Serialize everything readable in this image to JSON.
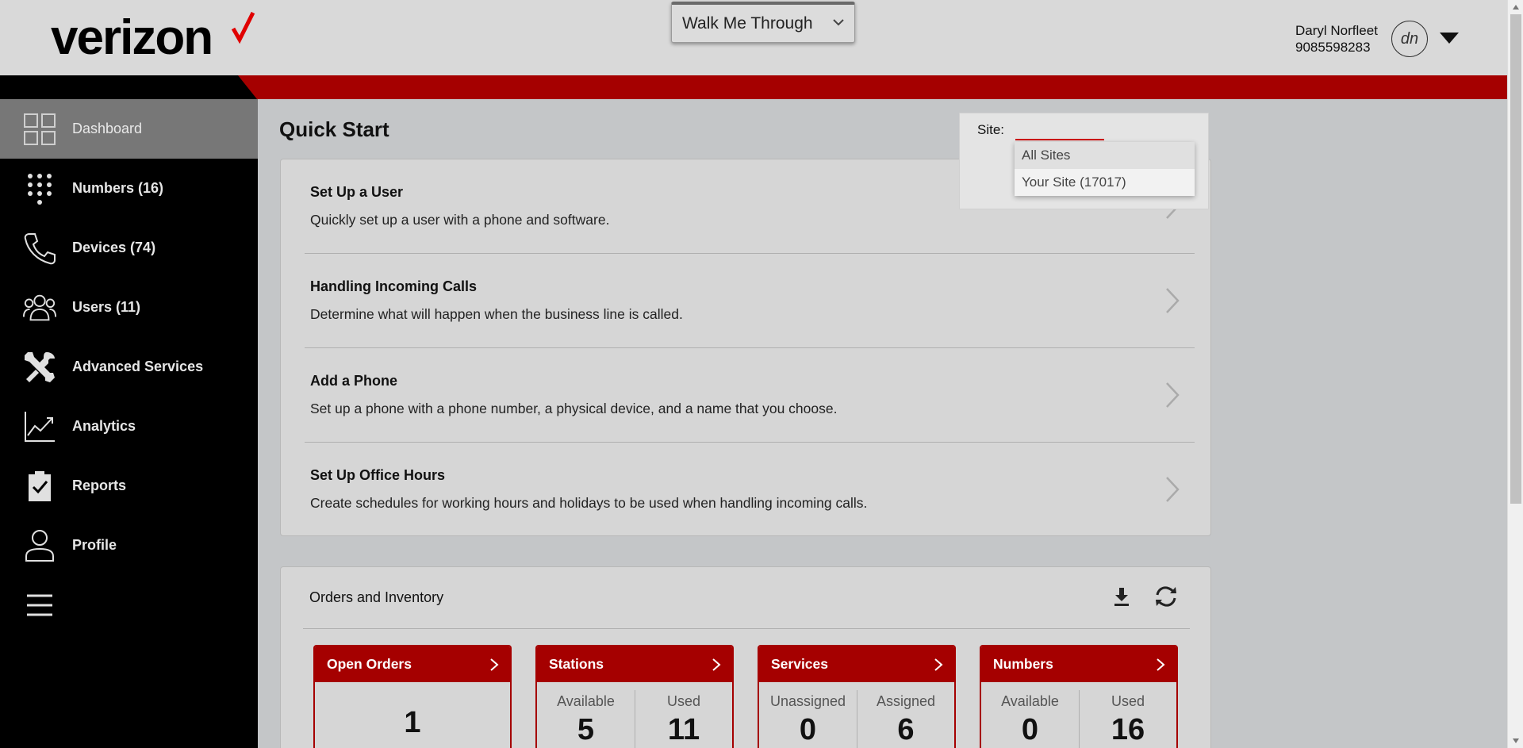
{
  "header": {
    "logo_text": "verizon",
    "walkme_label": "Walk Me Through",
    "user_name": "Daryl Norfleet",
    "user_phone": "9085598283",
    "avatar_initials": "dn"
  },
  "sidebar": {
    "items": [
      {
        "label": "Dashboard",
        "icon": "dashboard-grid-icon",
        "active": true
      },
      {
        "label": "Numbers (16)",
        "icon": "keypad-icon"
      },
      {
        "label": "Devices (74)",
        "icon": "phone-handset-icon"
      },
      {
        "label": "Users (11)",
        "icon": "users-group-icon"
      },
      {
        "label": "Advanced Services",
        "icon": "tools-icon"
      },
      {
        "label": "Analytics",
        "icon": "line-chart-icon"
      },
      {
        "label": "Reports",
        "icon": "clipboard-check-icon"
      },
      {
        "label": "Profile",
        "icon": "person-icon"
      }
    ],
    "menu_icon": "hamburger-icon"
  },
  "main": {
    "title": "Quick Start",
    "quick_start": [
      {
        "title": "Set Up a User",
        "desc": "Quickly set up a user with a phone and software."
      },
      {
        "title": "Handling Incoming Calls",
        "desc": "Determine what will happen when the business line is called."
      },
      {
        "title": "Add a Phone",
        "desc": "Set up a phone with a phone number, a physical device, and a name that you choose."
      },
      {
        "title": "Set Up Office Hours",
        "desc": "Create schedules for working hours and holidays to be used when handling incoming calls."
      }
    ],
    "site": {
      "label": "Site:",
      "value": "",
      "options": [
        "All Sites",
        "Your Site (17017)"
      ]
    },
    "orders": {
      "title": "Orders and Inventory",
      "tiles": [
        {
          "title": "Open Orders",
          "value": "1"
        },
        {
          "title": "Stations",
          "left_label": "Available",
          "left_value": "5",
          "right_label": "Used",
          "right_value": "11"
        },
        {
          "title": "Services",
          "left_label": "Unassigned",
          "left_value": "0",
          "right_label": "Assigned",
          "right_value": "6"
        },
        {
          "title": "Numbers",
          "left_label": "Available",
          "left_value": "0",
          "right_label": "Used",
          "right_value": "16"
        }
      ]
    }
  },
  "colors": {
    "brand_red": "#a50000",
    "sidebar_bg": "#000000",
    "active_nav": "#777777"
  }
}
